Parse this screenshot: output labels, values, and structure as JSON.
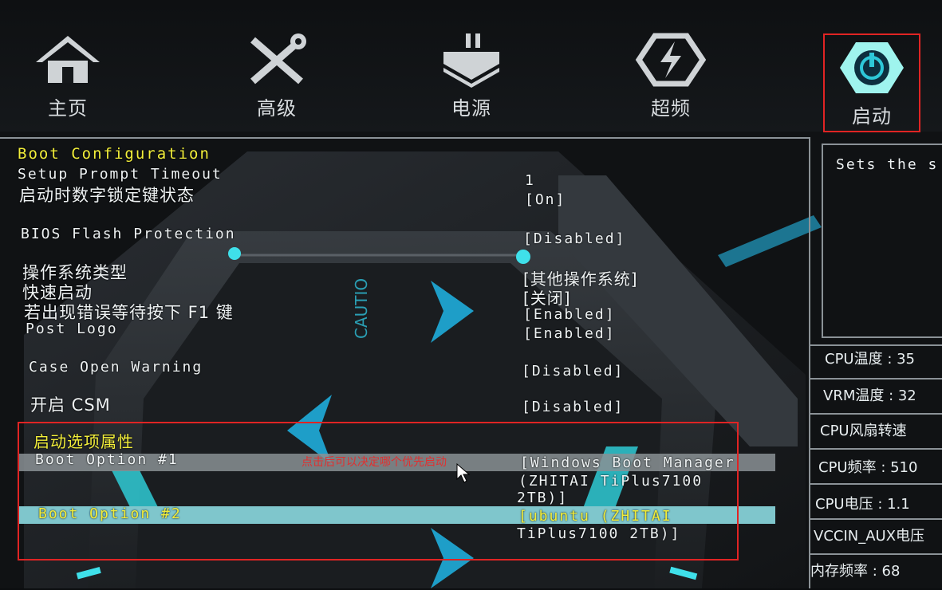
{
  "nav": {
    "items": [
      {
        "label": "主页",
        "icon": "home-icon"
      },
      {
        "label": "高级",
        "icon": "tools-icon"
      },
      {
        "label": "电源",
        "icon": "power-plug-icon"
      },
      {
        "label": "超频",
        "icon": "overclock-icon"
      },
      {
        "label": "启动",
        "icon": "power-button-icon"
      }
    ],
    "active": "启动"
  },
  "section_title": "Boot Configuration",
  "settings": [
    {
      "label": "Setup Prompt Timeout",
      "value": "1"
    },
    {
      "label": "启动时数字锁定键状态",
      "value": "[On]"
    },
    {
      "label": "BIOS Flash Protection",
      "value": "[Disabled]"
    },
    {
      "label": "操作系统类型",
      "value": "[其他操作系统]"
    },
    {
      "label": "快速启动",
      "value": "[关闭]"
    },
    {
      "label": "若出现错误等待按下 F1 键",
      "value": "[Enabled]"
    },
    {
      "label": "Post Logo",
      "value": "[Enabled]"
    },
    {
      "label": "Case Open Warning",
      "value": "[Disabled]"
    },
    {
      "label": "开启 CSM",
      "value": "[Disabled]"
    }
  ],
  "boot_section_title": "启动选项属性",
  "boot_options": [
    {
      "label": "Boot Option #1",
      "value_lines": [
        "[Windows Boot Manager",
        "(ZHITAI TiPlus7100",
        "2TB)]"
      ]
    },
    {
      "label": "Boot Option #2",
      "value_lines": [
        "[ubuntu (ZHITAI",
        "TiPlus7100 2TB)]"
      ]
    }
  ],
  "annotation": "点击后可以决定哪个优先启动",
  "help_text": "Sets the s",
  "stats": [
    "CPU温度 : 35",
    "VRM温度 : 32",
    "CPU风扇转速",
    "CPU频率 : 510",
    "CPU电压 : 1.1",
    "VCCIN_AUX电压",
    "内存频率 : 68"
  ],
  "colors": {
    "accent_cyan": "#2ec8d8",
    "highlight_yellow": "#f2ee3a",
    "annotation_red": "#e02424",
    "selected_row": "#7fc6cc"
  }
}
